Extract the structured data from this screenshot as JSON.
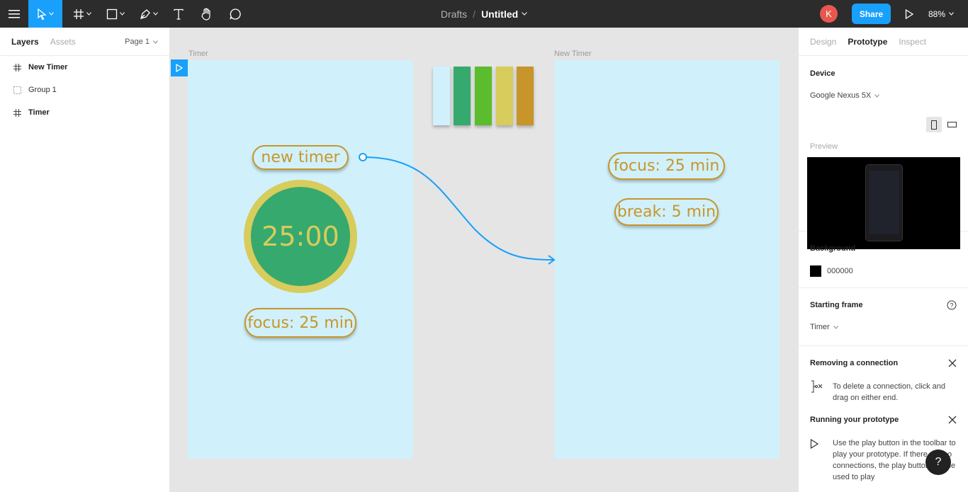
{
  "toolbar": {
    "tools": [
      "menu-icon",
      "move-tool-icon",
      "frame-tool-icon",
      "shape-tool-icon",
      "pen-tool-icon",
      "text-tool-icon",
      "hand-tool-icon",
      "comment-tool-icon"
    ],
    "breadcrumb_folder": "Drafts",
    "breadcrumb_sep": "/",
    "file_name": "Untitled",
    "avatar_initial": "K",
    "share_label": "Share",
    "zoom": "88%",
    "accent": "#18a0fb"
  },
  "left_panel": {
    "tabs": [
      "Layers",
      "Assets"
    ],
    "page": "Page 1",
    "layers": [
      {
        "name": "New Timer",
        "type": "frame"
      },
      {
        "name": "Group 1",
        "type": "group"
      },
      {
        "name": "Timer",
        "type": "frame"
      }
    ]
  },
  "canvas": {
    "frames": [
      {
        "label": "Timer",
        "buttons": [
          "new timer",
          "focus: 25 min"
        ],
        "timer_text": "25:00"
      },
      {
        "label": "New Timer",
        "buttons": [
          "focus: 25 min",
          "break: 5 min"
        ]
      }
    ],
    "palette": [
      "#d0f1fb",
      "#36a96e",
      "#5bbd2e",
      "#d7cc5c",
      "#c8952a"
    ],
    "frame_bg": "#d0f1fb",
    "connection_color": "#18a0fb"
  },
  "right_panel": {
    "tabs": [
      "Design",
      "Prototype",
      "Inspect"
    ],
    "active_tab": "Prototype",
    "device_heading": "Device",
    "device": "Google Nexus 5X",
    "preview_label": "Preview",
    "background_heading": "Background",
    "background_value": "000000",
    "starting_frame_heading": "Starting frame",
    "starting_frame": "Timer",
    "tips": [
      {
        "title": "Removing a connection",
        "text": "To delete a connection, click and drag on either end."
      },
      {
        "title": "Running your prototype",
        "text": "Use the play button in the toolbar to play your prototype. If there are no connections, the play button can be used to play"
      }
    ]
  },
  "help_label": "?"
}
